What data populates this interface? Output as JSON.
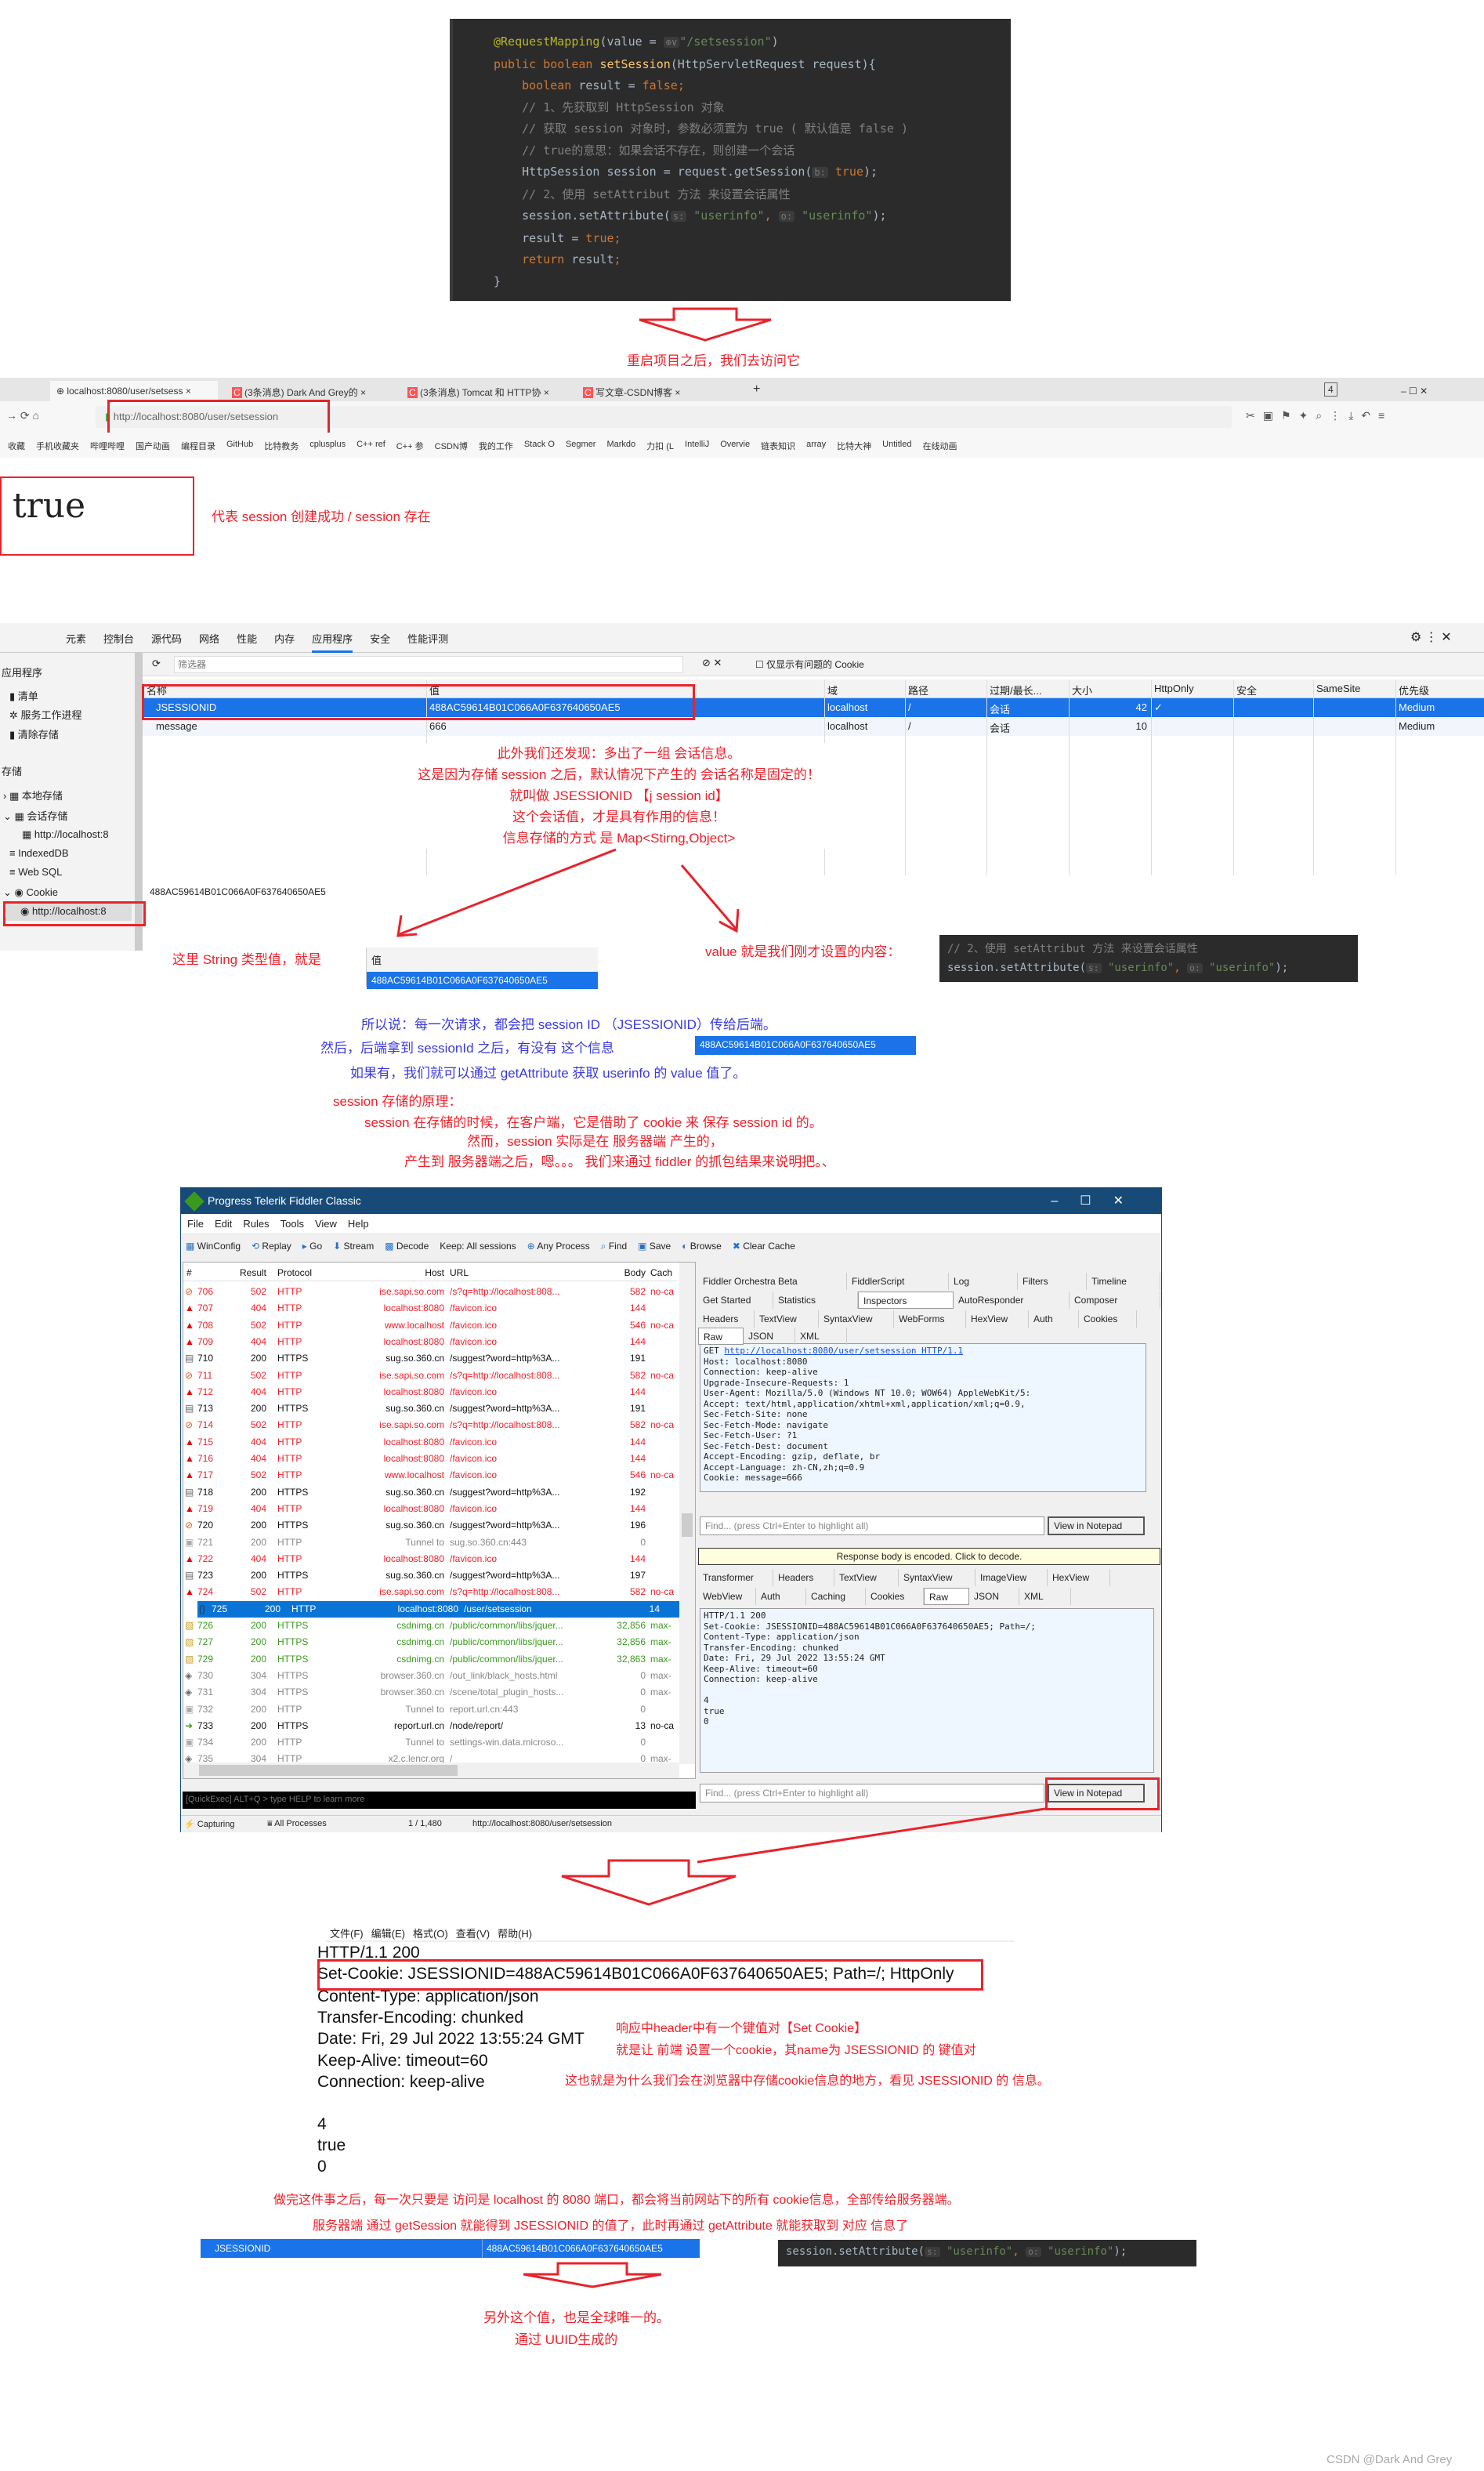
{
  "code_top": {
    "lines": [
      [
        [
          "@RequestMapping",
          "ann"
        ],
        [
          "(value = ",
          "plain"
        ],
        [
          "⊕∨",
          "hint"
        ],
        [
          "\"/setsession\"",
          "str"
        ],
        [
          ")",
          "plain"
        ]
      ],
      [
        [
          "public boolean ",
          "kw"
        ],
        [
          "setSession",
          "fn"
        ],
        [
          "(HttpServletRequest request){",
          "plain"
        ]
      ],
      [
        [
          "    boolean ",
          "kw"
        ],
        [
          "result",
          "plain"
        ],
        [
          " = ",
          "plain"
        ],
        [
          "false",
          "kw"
        ],
        [
          ";",
          "kw"
        ]
      ],
      [
        [
          "    // 1、先获取到 HttpSession 对象",
          "cmt"
        ]
      ],
      [
        [
          "    // 获取 session 对象时，参数必须置为 true ( 默认值是 false )",
          "cmt"
        ]
      ],
      [
        [
          "    // true的意思：如果会话不存在，则创建一个会话",
          "cmt"
        ]
      ],
      [
        [
          "    HttpSession session = request.getSession(",
          "plain"
        ],
        [
          "b:",
          "hint"
        ],
        [
          " true",
          "kw"
        ],
        [
          ");",
          "plain"
        ]
      ],
      [
        [
          "    // 2、使用 setAttribut 方法 来设置会话属性",
          "cmt"
        ]
      ],
      [
        [
          "    session.setAttribute(",
          "plain"
        ],
        [
          "s:",
          "hint"
        ],
        [
          " \"userinfo\"",
          "str"
        ],
        [
          ", ",
          "kw"
        ],
        [
          "o:",
          "hint"
        ],
        [
          " \"userinfo\"",
          "str"
        ],
        [
          ");",
          "plain"
        ]
      ],
      [
        [
          "    result",
          "plain"
        ],
        [
          " = ",
          "plain"
        ],
        [
          "true",
          "kw"
        ],
        [
          ";",
          "kw"
        ]
      ],
      [
        [
          "    return ",
          "kw"
        ],
        [
          "result",
          "plain"
        ],
        [
          ";",
          "kw"
        ]
      ],
      [
        [
          "}",
          "plain"
        ]
      ]
    ]
  },
  "note_restart": "重启项目之后，我们去访问它",
  "browser": {
    "tabs": [
      "localhost:8080/user/setsess",
      "(3条消息) Dark And Grey的",
      "(3条消息) Tomcat 和 HTTP协",
      "写文章-CSDN博客"
    ],
    "tab_count": "4",
    "url": "http://localhost:8080/user/setsession",
    "bookmarks": [
      "收藏",
      "手机收藏夹",
      "哔哩哔哩",
      "国产动画",
      "编程目录",
      "GitHub",
      "比特教务",
      "cplusplus",
      "C++ ref",
      "C++ 参",
      "CSDN博",
      "我的工作",
      "Stack O",
      "Segmer",
      "Markdo",
      "力扣 (L",
      "IntelliJ",
      "Overvie",
      "链表知识",
      "array",
      "比特大神",
      "Untitled",
      "在线动画"
    ],
    "page_body": "true"
  },
  "note_true": "代表 session 创建成功 / session 存在",
  "devtools": {
    "tabs": [
      "元素",
      "控制台",
      "源代码",
      "网络",
      "性能",
      "内存",
      "应用程序",
      "安全",
      "性能评测"
    ],
    "active_tab": "应用程序",
    "filter_placeholder": "筛选器",
    "only_issues_label": "仅显示有问题的 Cookie",
    "sidebar": {
      "app_heading": "应用程序",
      "manifest": "清单",
      "service_workers": "服务工作进程",
      "clear_storage": "清除存储",
      "storage_heading": "存储",
      "local_storage": "本地存储",
      "session_storage": "会话存储",
      "session_origin": "http://localhost:8",
      "indexeddb": "IndexedDB",
      "websql": "Web SQL",
      "cookie": "Cookie",
      "cookie_origin": "http://localhost:8"
    },
    "columns": [
      "名称",
      "值",
      "域",
      "路径",
      "过期/最长...",
      "大小",
      "HttpOnly",
      "安全",
      "SameSite",
      "优先级"
    ],
    "rows": [
      {
        "name": "JSESSIONID",
        "value": "488AC59614B01C066A0F637640650AE5",
        "domain": "localhost",
        "path": "/",
        "expires": "会话",
        "size": "42",
        "httponly": "✓",
        "secure": "",
        "samesite": "",
        "priority": "Medium"
      },
      {
        "name": "message",
        "value": "666",
        "domain": "localhost",
        "path": "/",
        "expires": "会话",
        "size": "10",
        "httponly": "",
        "secure": "",
        "samesite": "",
        "priority": "Medium"
      }
    ],
    "value_preview": "488AC59614B01C066A0F637640650AE5"
  },
  "notes_cookie": [
    "此外我们还发现：多出了一组 会话信息。",
    "这是因为存储 session 之后，默认情况下产生的 会话名称是固定的！",
    "就叫做 JSESSIONID 【j session id】",
    "这个会话值，才是具有作用的信息！",
    "信息存储的方式 是 Map<Stirng,Object>"
  ],
  "note_string_value": "这里 String 类型值，就是",
  "value_header": "值",
  "value_cell": "488AC59614B01C066A0F637640650AE5",
  "note_value_content": "value 就是我们刚才设置的内容：",
  "code_snip1": {
    "comment": "// 2、使用 setAttribut 方法 来设置会话属性",
    "call": "session.setAttribute(",
    "s_hint": "s:",
    "arg1": "\"userinfo\"",
    "o_hint": "o:",
    "arg2": "\"userinfo\"",
    "end": ");"
  },
  "notes_blue": [
    "所以说：每一次请求，都会把 session ID （JSESSIONID）传给后端。",
    "然后，后端拿到 sessionId 之后，有没有 这个信息",
    "如果有，我们就可以通过 getAttribute 获取 userinfo 的 value 值了。"
  ],
  "blue_session_value": "488AC59614B01C066A0F637640650AE5",
  "notes_principle": [
    "session 存储的原理：",
    "session 在存储的时候，在客户端，它是借助了 cookie 来 保存 session id 的。",
    "然而，session 实际是在 服务器端 产生的，",
    "产生到 服务器端之后，嗯。。。 我们来通过 fiddler 的抓包结果来说明把。、"
  ],
  "fiddler": {
    "title": "Progress Telerik Fiddler Classic",
    "menu": [
      "File",
      "Edit",
      "Rules",
      "Tools",
      "View",
      "Help"
    ],
    "toolbar": [
      "WinConfig",
      "Replay",
      "Go",
      "Stream",
      "Decode",
      "Keep: All sessions",
      "Any Process",
      "Find",
      "Save",
      "Browse",
      "Clear Cache"
    ],
    "columns": [
      "#",
      "Result",
      "Protocol",
      "Host",
      "URL",
      "Body",
      "Cach"
    ],
    "sessions": [
      {
        "id": "706",
        "result": "502",
        "protocol": "HTTP",
        "host": "ise.sapi.so.com",
        "url": "/s?q=http://localhost:808...",
        "body": "582",
        "caching": "no-ca",
        "status": "err",
        "icon": "blocked-icon"
      },
      {
        "id": "707",
        "result": "404",
        "protocol": "HTTP",
        "host": "localhost:8080",
        "url": "/favicon.ico",
        "body": "144",
        "caching": "",
        "status": "err",
        "icon": "warning-icon"
      },
      {
        "id": "708",
        "result": "502",
        "protocol": "HTTP",
        "host": "www.localhost",
        "url": "/favicon.ico",
        "body": "546",
        "caching": "no-ca",
        "status": "err",
        "icon": "warning-icon"
      },
      {
        "id": "709",
        "result": "404",
        "protocol": "HTTP",
        "host": "localhost:8080",
        "url": "/favicon.ico",
        "body": "144",
        "caching": "",
        "status": "err",
        "icon": "warning-icon"
      },
      {
        "id": "710",
        "result": "200",
        "protocol": "HTTPS",
        "host": "sug.so.360.cn",
        "url": "/suggest?word=http%3A...",
        "body": "191",
        "caching": "",
        "status": "ok",
        "icon": "document-icon"
      },
      {
        "id": "711",
        "result": "502",
        "protocol": "HTTP",
        "host": "ise.sapi.so.com",
        "url": "/s?q=http://localhost:808...",
        "body": "582",
        "caching": "no-ca",
        "status": "err",
        "icon": "blocked-icon"
      },
      {
        "id": "712",
        "result": "404",
        "protocol": "HTTP",
        "host": "localhost:8080",
        "url": "/favicon.ico",
        "body": "144",
        "caching": "",
        "status": "err",
        "icon": "warning-icon"
      },
      {
        "id": "713",
        "result": "200",
        "protocol": "HTTPS",
        "host": "sug.so.360.cn",
        "url": "/suggest?word=http%3A...",
        "body": "191",
        "caching": "",
        "status": "ok",
        "icon": "document-icon"
      },
      {
        "id": "714",
        "result": "502",
        "protocol": "HTTP",
        "host": "ise.sapi.so.com",
        "url": "/s?q=http://localhost:808...",
        "body": "582",
        "caching": "no-ca",
        "status": "err",
        "icon": "blocked-icon"
      },
      {
        "id": "715",
        "result": "404",
        "protocol": "HTTP",
        "host": "localhost:8080",
        "url": "/favicon.ico",
        "body": "144",
        "caching": "",
        "status": "err",
        "icon": "warning-icon"
      },
      {
        "id": "716",
        "result": "404",
        "protocol": "HTTP",
        "host": "localhost:8080",
        "url": "/favicon.ico",
        "body": "144",
        "caching": "",
        "status": "err",
        "icon": "warning-icon"
      },
      {
        "id": "717",
        "result": "502",
        "protocol": "HTTP",
        "host": "www.localhost",
        "url": "/favicon.ico",
        "body": "546",
        "caching": "no-ca",
        "status": "err",
        "icon": "warning-icon"
      },
      {
        "id": "718",
        "result": "200",
        "protocol": "HTTPS",
        "host": "sug.so.360.cn",
        "url": "/suggest?word=http%3A...",
        "body": "192",
        "caching": "",
        "status": "ok",
        "icon": "document-icon"
      },
      {
        "id": "719",
        "result": "404",
        "protocol": "HTTP",
        "host": "localhost:8080",
        "url": "/favicon.ico",
        "body": "144",
        "caching": "",
        "status": "err",
        "icon": "warning-icon"
      },
      {
        "id": "720",
        "result": "200",
        "protocol": "HTTPS",
        "host": "sug.so.360.cn",
        "url": "/suggest?word=http%3A...",
        "body": "196",
        "caching": "",
        "status": "ok",
        "icon": "blocked-icon"
      },
      {
        "id": "721",
        "result": "200",
        "protocol": "HTTP",
        "host": "Tunnel to",
        "url": "sug.so.360.cn:443",
        "body": "0",
        "caching": "",
        "status": "gray",
        "icon": "lock-icon"
      },
      {
        "id": "722",
        "result": "404",
        "protocol": "HTTP",
        "host": "localhost:8080",
        "url": "/favicon.ico",
        "body": "144",
        "caching": "",
        "status": "err",
        "icon": "warning-icon"
      },
      {
        "id": "723",
        "result": "200",
        "protocol": "HTTPS",
        "host": "sug.so.360.cn",
        "url": "/suggest?word=http%3A...",
        "body": "197",
        "caching": "",
        "status": "ok",
        "icon": "document-icon"
      },
      {
        "id": "724",
        "result": "502",
        "protocol": "HTTP",
        "host": "ise.sapi.so.com",
        "url": "/s?q=http://localhost:808...",
        "body": "582",
        "caching": "no-ca",
        "status": "err",
        "icon": "warning-icon"
      },
      {
        "id": "725",
        "result": "200",
        "protocol": "HTTP",
        "host": "localhost:8080",
        "url": "/user/setsession",
        "body": "14",
        "caching": "",
        "status": "sel",
        "icon": "json-icon"
      },
      {
        "id": "726",
        "result": "200",
        "protocol": "HTTPS",
        "host": "csdnimg.cn",
        "url": "/public/common/libs/jquer...",
        "body": "32,856",
        "caching": "max-",
        "status": "green",
        "icon": "script-icon"
      },
      {
        "id": "727",
        "result": "200",
        "protocol": "HTTPS",
        "host": "csdnimg.cn",
        "url": "/public/common/libs/jquer...",
        "body": "32,856",
        "caching": "max-",
        "status": "green",
        "icon": "script-icon"
      },
      {
        "id": "729",
        "result": "200",
        "protocol": "HTTPS",
        "host": "csdnimg.cn",
        "url": "/public/common/libs/jquer...",
        "body": "32,863",
        "caching": "max-",
        "status": "green",
        "icon": "script-icon"
      },
      {
        "id": "730",
        "result": "304",
        "protocol": "HTTPS",
        "host": "browser.360.cn",
        "url": "/out_link/black_hosts.html",
        "body": "0",
        "caching": "max-",
        "status": "gray",
        "icon": "not-modified-icon"
      },
      {
        "id": "731",
        "result": "304",
        "protocol": "HTTPS",
        "host": "browser.360.cn",
        "url": "/scene/total_plugin_hosts...",
        "body": "0",
        "caching": "max-",
        "status": "gray",
        "icon": "not-modified-icon"
      },
      {
        "id": "732",
        "result": "200",
        "protocol": "HTTP",
        "host": "Tunnel to",
        "url": "report.url.cn:443",
        "body": "0",
        "caching": "",
        "status": "gray",
        "icon": "lock-icon"
      },
      {
        "id": "733",
        "result": "200",
        "protocol": "HTTPS",
        "host": "report.url.cn",
        "url": "/node/report/",
        "body": "13",
        "caching": "no-ca",
        "status": "ok",
        "icon": "upload-icon"
      },
      {
        "id": "734",
        "result": "200",
        "protocol": "HTTP",
        "host": "Tunnel to",
        "url": "settings-win.data.microso...",
        "body": "0",
        "caching": "",
        "status": "gray",
        "icon": "lock-icon"
      },
      {
        "id": "735",
        "result": "304",
        "protocol": "HTTP",
        "host": "x2.c.lencr.org",
        "url": "/",
        "body": "0",
        "caching": "max-",
        "status": "gray",
        "icon": "not-modified-icon"
      }
    ],
    "quickexec": "[QuickExec] ALT+Q > type HELP to learn more",
    "status": {
      "capturing": "Capturing",
      "processes": "All Processes",
      "count": "1 / 1,480",
      "url": "http://localhost:8080/user/setsession"
    },
    "tabs_row1": [
      "Fiddler Orchestra Beta",
      "FiddlerScript",
      "Log",
      "Filters",
      "Timeline"
    ],
    "tabs_row2": [
      "Get Started",
      "Statistics",
      "Inspectors",
      "AutoResponder",
      "Composer"
    ],
    "req_tabs": [
      "Headers",
      "TextView",
      "SyntaxView",
      "WebForms",
      "HexView",
      "Auth",
      "Cookies"
    ],
    "req_tabs2": [
      "Raw",
      "JSON",
      "XML"
    ],
    "request_raw": "GET http://localhost:8080/user/setsession HTTP/1.1\nHost: localhost:8080\nConnection: keep-alive\nUpgrade-Insecure-Requests: 1\nUser-Agent: Mozilla/5.0 (Windows NT 10.0; WOW64) AppleWebKit/5:\nAccept: text/html,application/xhtml+xml,application/xml;q=0.9,\nSec-Fetch-Site: none\nSec-Fetch-Mode: navigate\nSec-Fetch-User: ?1\nSec-Fetch-Dest: document\nAccept-Encoding: gzip, deflate, br\nAccept-Language: zh-CN,zh;q=0.9\nCookie: message=666",
    "find_placeholder": "Find... (press Ctrl+Enter to highlight all)",
    "view_notepad": "View in Notepad",
    "decode_banner": "Response body is encoded. Click to decode.",
    "resp_tabs": [
      "Transformer",
      "Headers",
      "TextView",
      "SyntaxView",
      "ImageView",
      "HexView"
    ],
    "resp_tabs2": [
      "WebView",
      "Auth",
      "Caching",
      "Cookies",
      "Raw",
      "JSON",
      "XML"
    ],
    "response_raw": "HTTP/1.1 200\nSet-Cookie: JSESSIONID=488AC59614B01C066A0F637640650AE5; Path=/;\nContent-Type: application/json\nTransfer-Encoding: chunked\nDate: Fri, 29 Jul 2022 13:55:24 GMT\nKeep-Alive: timeout=60\nConnection: keep-alive\n\n4\ntrue\n0"
  },
  "notepad": {
    "menu": [
      "文件(F)",
      "编辑(E)",
      "格式(O)",
      "查看(V)",
      "帮助(H)"
    ],
    "lines": [
      "HTTP/1.1 200",
      "Set-Cookie: JSESSIONID=488AC59614B01C066A0F637640650AE5; Path=/; HttpOnly",
      "Content-Type: application/json",
      "Transfer-Encoding: chunked",
      "Date: Fri, 29 Jul 2022 13:55:24 GMT",
      "Keep-Alive: timeout=60",
      "Connection: keep-alive",
      "",
      "4",
      "true",
      "0"
    ]
  },
  "notes_setcookie": [
    "响应中header中有一个键值对【Set Cookie】",
    "就是让 前端 设置一个cookie，其name为 JSESSIONID 的 键值对",
    "这也就是为什么我们会在浏览器中存储cookie信息的地方，看见 JSESSIONID 的 信息。"
  ],
  "notes_after": [
    "做完这件事之后，每一次只要是 访问是 localhost 的 8080 端口，都会将当前网站下的所有 cookie信息，全部传给服务器端。",
    "服务器端 通过 getSession 就能得到 JSESSIONID 的值了，此时再通过 getAttribute 就能获取到 对应 信息了"
  ],
  "bottom_row": {
    "name": "JSESSIONID",
    "value": "488AC59614B01C066A0F637640650AE5"
  },
  "notes_uuid": [
    "另外这个值，也是全球唯一的。",
    "通过 UUID生成的"
  ],
  "watermark": "CSDN @Dark And Grey",
  "colors": {
    "annotation_red": "#f0202a",
    "annotation_blue": "#3a3ae0",
    "selection_blue": "#1a73e8",
    "fiddler_title": "#184a78",
    "code_bg": "#2b2b2b"
  }
}
